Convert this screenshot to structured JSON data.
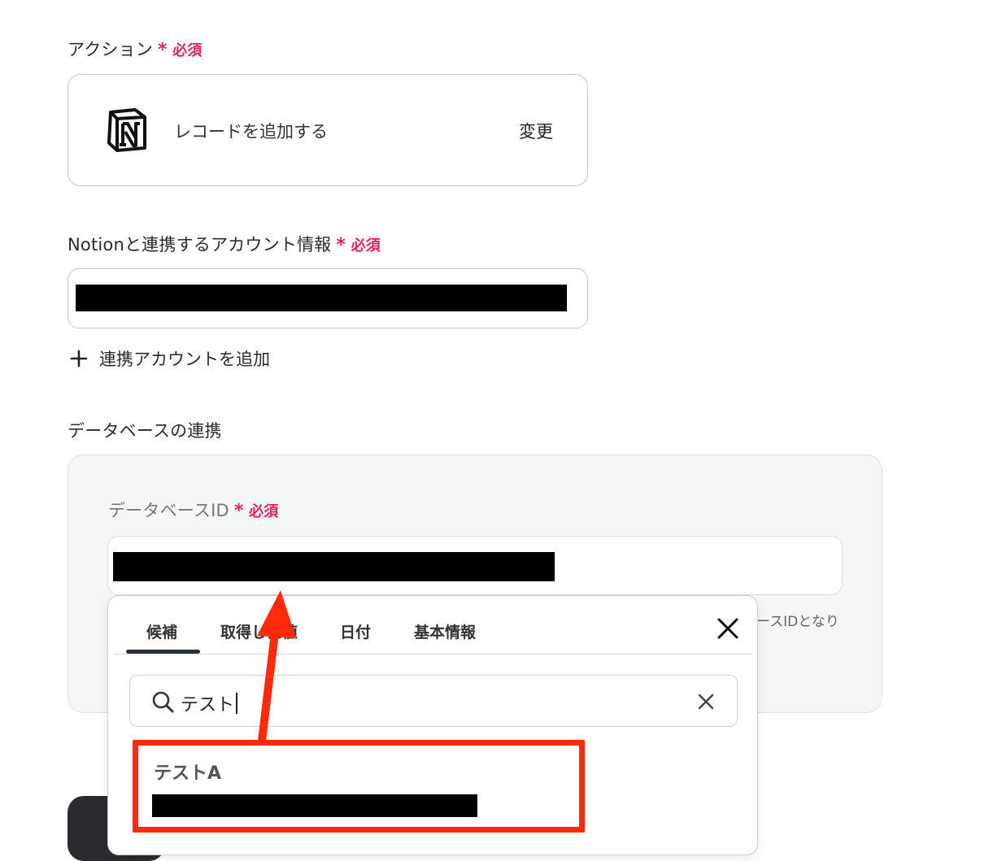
{
  "action": {
    "label": "アクション",
    "required": "必須",
    "name": "レコードを追加する",
    "change": "変更",
    "icon": "notion-logo-icon"
  },
  "account": {
    "label": "Notionと連携するアカウント情報",
    "required": "必須",
    "add_label": "連携アカウントを追加"
  },
  "database": {
    "section_title": "データベースの連携",
    "id_label": "データベースID",
    "required": "必須",
    "helper_tail": "ースIDとなり"
  },
  "dropdown": {
    "tabs": [
      "候補",
      "取得した値",
      "日付",
      "基本情報"
    ],
    "active_tab": "候補",
    "search": {
      "value": "テスト",
      "icon": "search-icon"
    },
    "results": [
      {
        "title": "テストA"
      }
    ]
  },
  "colors": {
    "required": "#e0245e",
    "annotation": "#ff2a0a",
    "panel_bg": "#f5f6f8"
  }
}
